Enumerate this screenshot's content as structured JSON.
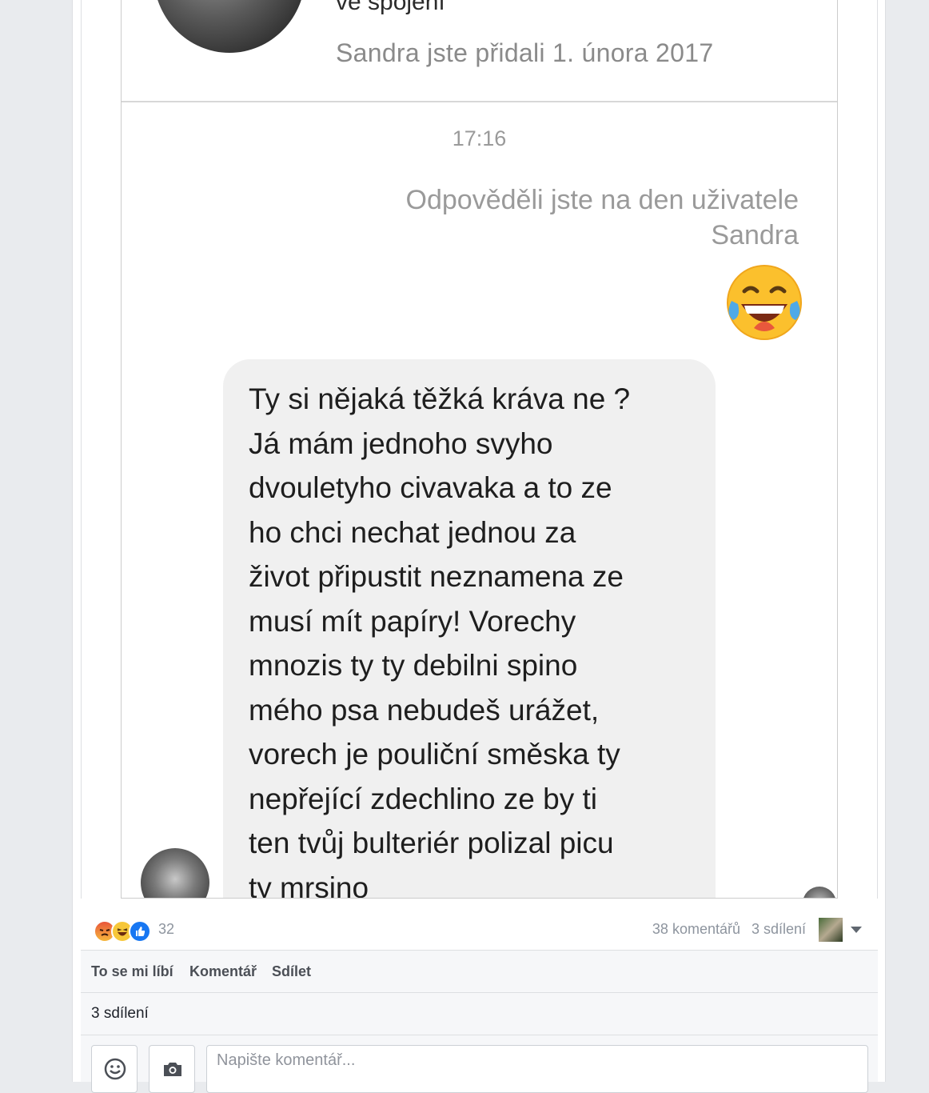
{
  "screenshot": {
    "connected_text": "ve spojení",
    "added_text": "Sandra jste přidali 1. února 2017",
    "time": "17:16",
    "reply_note": "Odpověděli jste na den uživatele Sandra",
    "emoji": "face-with-tears-of-joy-icon",
    "message_lines": [
      "Ty si nějaká těžká kráva ne ?",
      "Já mám jednoho svyho",
      "dvouletyho civavaka a to ze",
      "ho chci nechat jednou za",
      "život připustit neznamena ze",
      "musí mít papíry! Vorechy",
      "mnozis ty ty debilni spino",
      "mého psa nebudeš urážet,",
      "vorech je pouliční směska ty",
      "nepřející zdechlino ze by ti",
      "ten tvůj bulteriér polizal picu",
      "ty mrsino"
    ]
  },
  "stats": {
    "reactions": [
      "angry-icon",
      "haha-icon",
      "like-icon"
    ],
    "reaction_count": "32",
    "comments": "38 komentářů",
    "shares": "3 sdílení"
  },
  "actions": {
    "like": "To se mi líbí",
    "comment": "Komentář",
    "share": "Sdílet"
  },
  "shares_line": "3 sdílení",
  "composer": {
    "placeholder": "Napište komentář..."
  },
  "colors": {
    "background": "#e9ebee",
    "meta_text": "#8d949e",
    "like_blue": "#1877f2"
  }
}
